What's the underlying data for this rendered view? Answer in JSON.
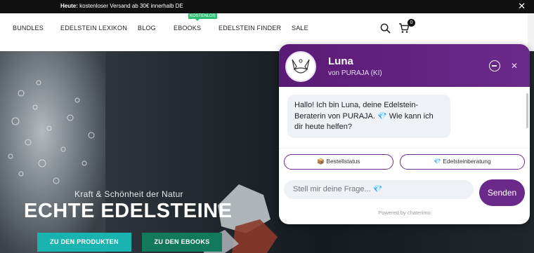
{
  "topbar": {
    "bold": "Heute:",
    "text": " kostenloser Versand ab 30€ innerhalb DE",
    "close": "✕"
  },
  "nav": {
    "items": [
      "BUNDLES",
      "EDELSTEIN LEXIKON",
      "BLOG",
      "EBOOKS",
      "EDELSTEIN FINDER",
      "SALE"
    ],
    "badge": "KOSTENLOS",
    "cart_count": "0"
  },
  "hero": {
    "subtitle": "Kraft & Schönheit der Natur",
    "title": "ECHTE EDELSTEINE",
    "button_products": "ZU DEN PRODUKTEN",
    "button_ebooks": "ZU DEN EBOOKS"
  },
  "chat": {
    "name": "Luna",
    "byline": "von PURAJA (KI)",
    "close": "✕",
    "message": "Hallo! Ich bin Luna, deine Edelstein-Beraterin von PURAJA. 💎 Wie kann ich dir heute helfen?",
    "chip_order": "📦 Bestellstatus",
    "chip_advice": "💎 Edelsteinberatung",
    "input_placeholder": "Stell mir deine Frage... 💎",
    "send": "Senden",
    "powered": "Powered by chaterimo"
  },
  "colors": {
    "brand_purple": "#6b2a8a",
    "teal_button": "#1ab4b0",
    "green_button": "#127a5a",
    "badge_green": "#2fbf71"
  }
}
